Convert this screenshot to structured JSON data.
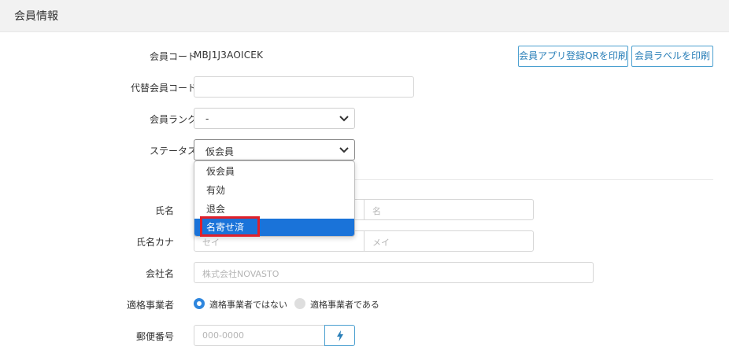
{
  "header": {
    "title": "会員情報"
  },
  "actions": {
    "print_qr": "会員アプリ登録QRを印刷",
    "print_label": "会員ラベルを印刷"
  },
  "fields": {
    "member_code": {
      "label": "会員コード",
      "value": "MBJ1J3AOICEK"
    },
    "alt_member_code": {
      "label": "代替会員コード",
      "value": ""
    },
    "member_rank": {
      "label": "会員ランク",
      "selected": "-"
    },
    "status": {
      "label": "ステータス",
      "selected": "仮会員",
      "options": [
        "仮会員",
        "有効",
        "退会",
        "名寄せ済"
      ],
      "highlighted_option": "名寄せ済"
    },
    "name": {
      "label": "氏名",
      "first_placeholder": "名"
    },
    "name_kana": {
      "label": "氏名カナ",
      "last_placeholder": "セイ",
      "first_placeholder": "メイ"
    },
    "company": {
      "label": "会社名",
      "placeholder": "株式会社NOVASTO"
    },
    "qualified_business": {
      "label": "適格事業者",
      "options": [
        "適格事業者ではない",
        "適格事業者である"
      ],
      "selected": "適格事業者ではない"
    },
    "postal_code": {
      "label": "郵便番号",
      "placeholder": "000-0000"
    }
  },
  "colors": {
    "accent": "#2e86de",
    "selected_option_bg": "#1a73d9",
    "highlight_border": "#e0202a",
    "button_border": "#4a9fd0"
  }
}
